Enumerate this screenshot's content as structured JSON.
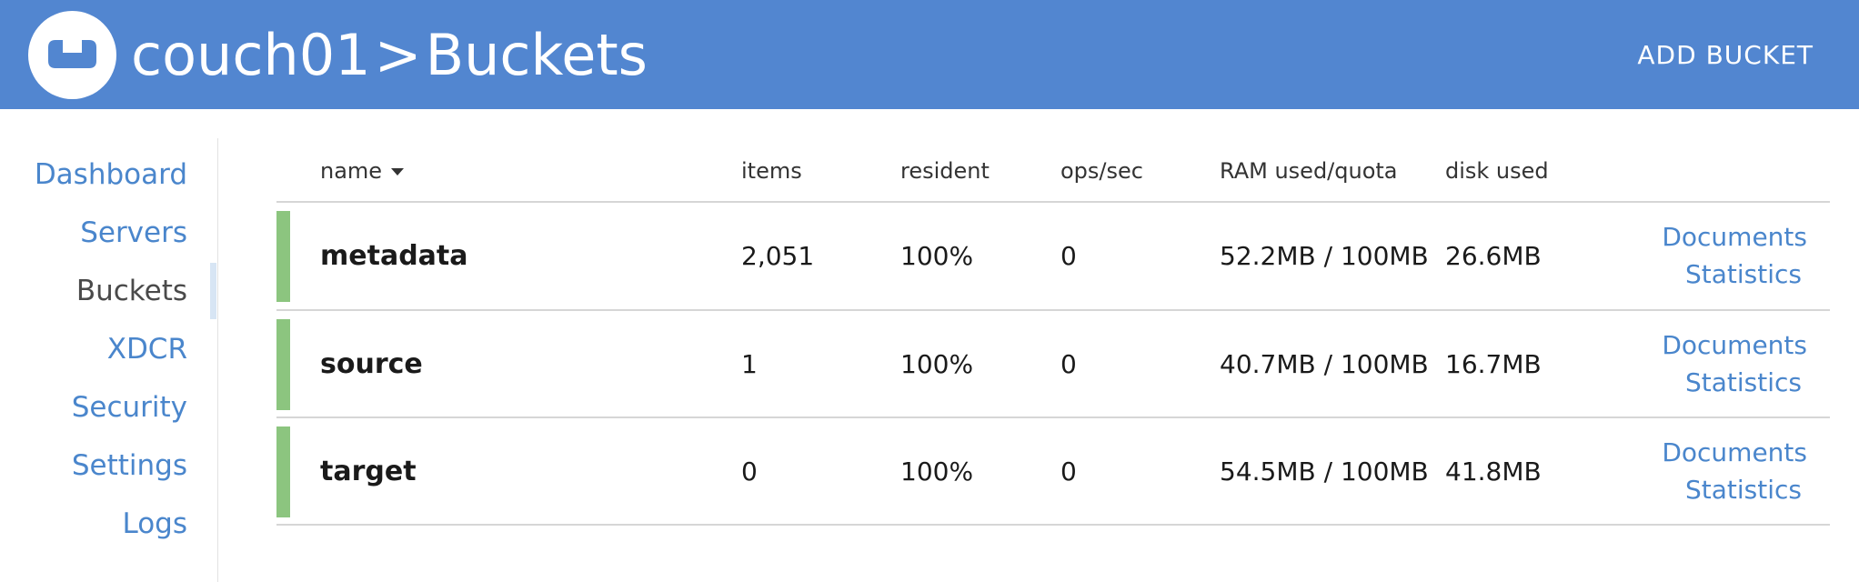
{
  "header": {
    "cluster_name": "couch01",
    "separator": ">",
    "page_title": "Buckets",
    "add_bucket_label": "ADD BUCKET",
    "logo_icon": "couchbase-logo-icon"
  },
  "sidebar": {
    "items": [
      {
        "label": "Dashboard",
        "active": false
      },
      {
        "label": "Servers",
        "active": false
      },
      {
        "label": "Buckets",
        "active": true
      },
      {
        "label": "XDCR",
        "active": false
      },
      {
        "label": "Security",
        "active": false
      },
      {
        "label": "Settings",
        "active": false
      },
      {
        "label": "Logs",
        "active": false
      }
    ]
  },
  "table": {
    "columns": {
      "name": "name",
      "items": "items",
      "resident": "resident",
      "ops": "ops/sec",
      "ram": "RAM used/quota",
      "disk": "disk used"
    },
    "sort_icon": "caret-down-icon",
    "rows": [
      {
        "name": "metadata",
        "items": "2,051",
        "resident": "100%",
        "ops": "0",
        "ram": "52.2MB / 100MB",
        "disk": "26.6MB",
        "documents_link": "Documents",
        "statistics_link": "Statistics"
      },
      {
        "name": "source",
        "items": "1",
        "resident": "100%",
        "ops": "0",
        "ram": "40.7MB / 100MB",
        "disk": "16.7MB",
        "documents_link": "Documents",
        "statistics_link": "Statistics"
      },
      {
        "name": "target",
        "items": "0",
        "resident": "100%",
        "ops": "0",
        "ram": "54.5MB / 100MB",
        "disk": "41.8MB",
        "documents_link": "Documents",
        "statistics_link": "Statistics"
      }
    ]
  },
  "colors": {
    "header_bg": "#5286d0",
    "link": "#4a86cc",
    "status_healthy": "#8cc57f"
  }
}
